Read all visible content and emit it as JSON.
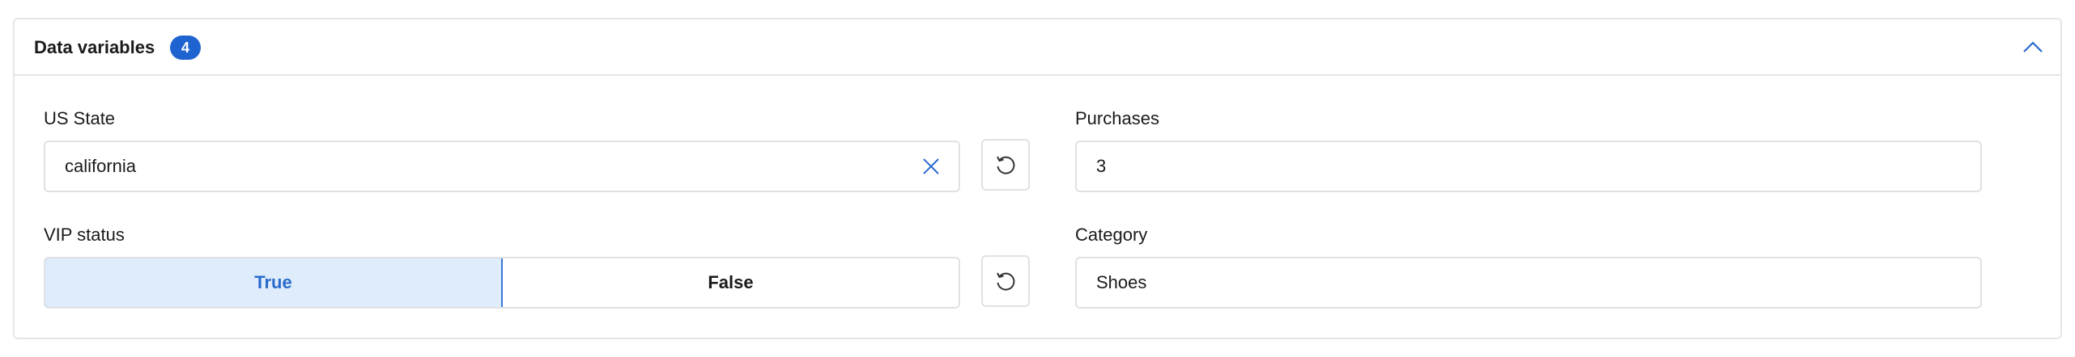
{
  "panel": {
    "title": "Data variables",
    "count": "4"
  },
  "fields": {
    "us_state": {
      "label": "US State",
      "value": "california"
    },
    "purchases": {
      "label": "Purchases",
      "value": "3"
    },
    "vip_status": {
      "label": "VIP status",
      "options": [
        "True",
        "False"
      ],
      "selected": "True"
    },
    "category": {
      "label": "Category",
      "value": "Shoes"
    }
  },
  "colors": {
    "accent": "#1f63d1",
    "active_bg": "#deecfb",
    "active_text": "#2a6acd",
    "border": "#dfe1e5"
  },
  "icons": {
    "collapse": "chevron-up-icon",
    "clear": "close-icon",
    "reset": "reset-icon"
  }
}
